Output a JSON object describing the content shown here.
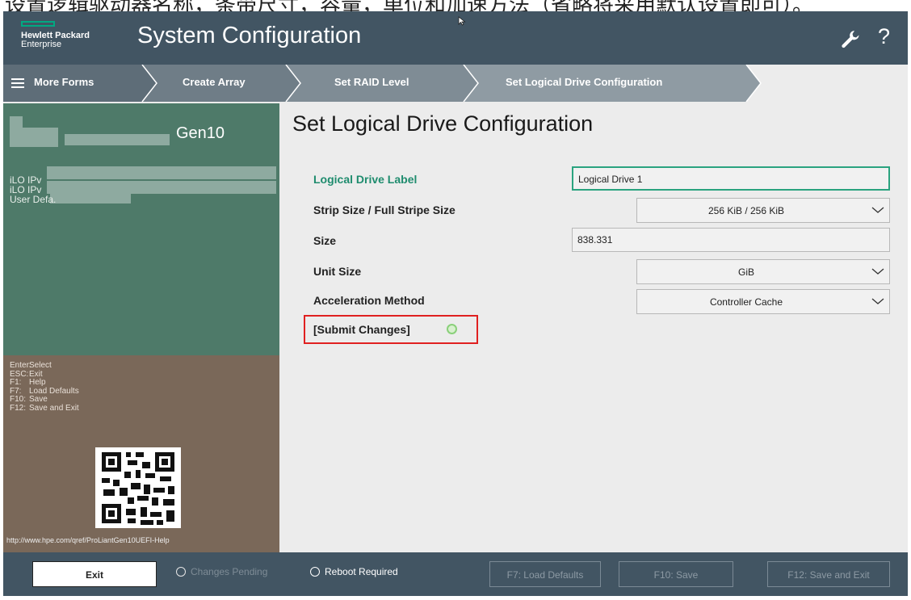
{
  "caption": "设置逻辑驱动器名称，条带尺寸，容量，单位和加速方法（省略将采用默认设置即可）。",
  "header": {
    "brand_line1": "Hewlett Packard",
    "brand_line2": "Enterprise",
    "title": "System Configuration",
    "help_glyph": "?"
  },
  "breadcrumb": {
    "items": [
      {
        "label": "More Forms"
      },
      {
        "label": "Create Array"
      },
      {
        "label": "Set RAID Level"
      },
      {
        "label": "Set Logical Drive Configuration"
      }
    ]
  },
  "server_panel": {
    "generation": "Gen10",
    "ilo_lines": [
      "iLO IPv",
      "iLO IPv",
      "User Defa."
    ]
  },
  "key_help": [
    {
      "key": "Enter:",
      "action": "Select"
    },
    {
      "key": "ESC:",
      "action": "Exit"
    },
    {
      "key": "F1:",
      "action": "Help"
    },
    {
      "key": "F7:",
      "action": "Load Defaults"
    },
    {
      "key": "F10:",
      "action": "Save"
    },
    {
      "key": "F12:",
      "action": "Save and Exit"
    }
  ],
  "help_url": "http://www.hpe.com/qref/ProLiantGen10UEFI-Help",
  "form": {
    "title": "Set Logical Drive Configuration",
    "logical_drive_label": {
      "label": "Logical Drive Label",
      "value": "Logical Drive 1"
    },
    "strip_size": {
      "label": "Strip Size / Full Stripe Size",
      "value": "256 KiB / 256 KiB"
    },
    "size": {
      "label": "Size",
      "value": "838.331"
    },
    "unit_size": {
      "label": "Unit Size",
      "value": "GiB"
    },
    "acceleration": {
      "label": "Acceleration Method",
      "value": "Controller Cache"
    },
    "submit_label": "[Submit Changes]"
  },
  "footer": {
    "exit_label": "Exit",
    "changes_pending": "Changes Pending",
    "reboot_required": "Reboot Required",
    "f7_label": "F7: Load Defaults",
    "f10_label": "F10: Save",
    "f12_label": "F12: Save and Exit"
  },
  "colors": {
    "header_bg": "#425563",
    "accent_green": "#01a982",
    "active_label": "#1f8c6e",
    "highlight_red": "#e02020"
  }
}
